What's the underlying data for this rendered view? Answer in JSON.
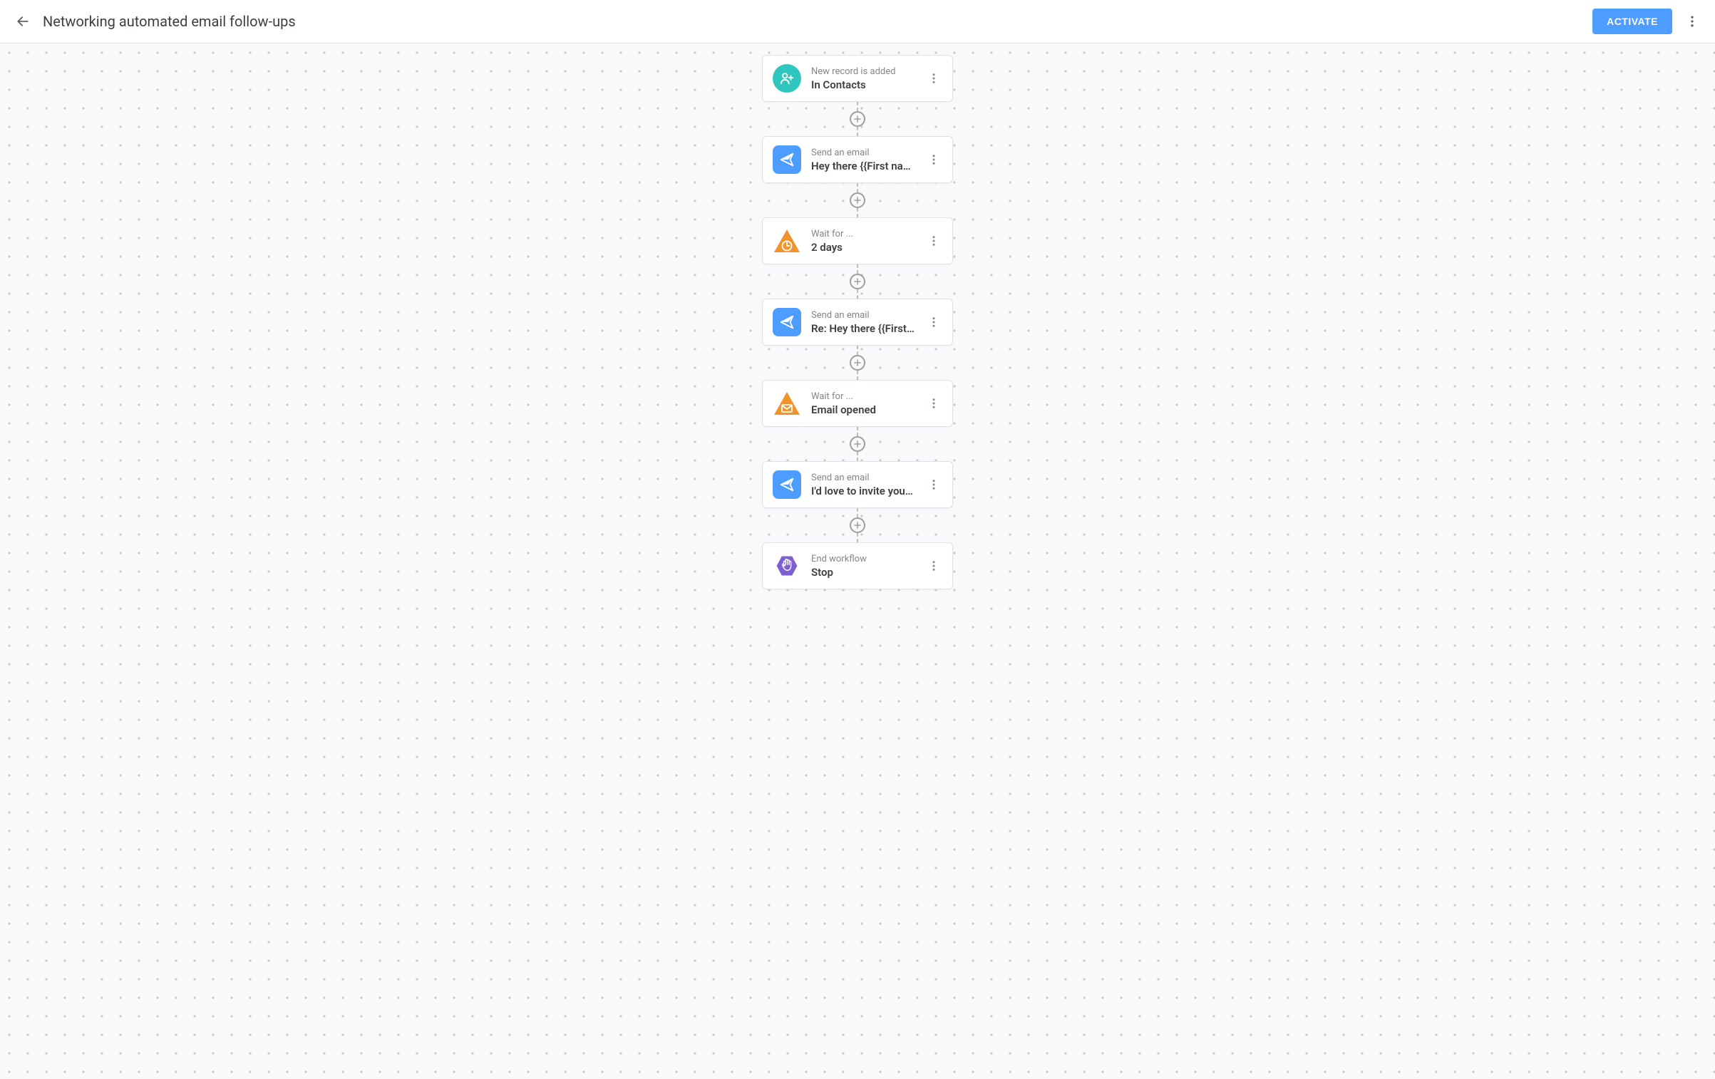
{
  "header": {
    "title": "Networking automated email follow-ups",
    "activate_label": "ACTIVATE"
  },
  "nodes": [
    {
      "label": "New record is added",
      "value": "In Contacts",
      "icon": "person-add",
      "icon_shape": "circle",
      "icon_color": "teal"
    },
    {
      "label": "Send an email",
      "value": "Hey there {{First name…",
      "icon": "send",
      "icon_shape": "rounded",
      "icon_color": "blue"
    },
    {
      "label": "Wait for ...",
      "value": "2 days",
      "icon": "triangle-clock",
      "icon_shape": "triangle",
      "icon_color": "orange"
    },
    {
      "label": "Send an email",
      "value": "Re: Hey there {{First n…",
      "icon": "send",
      "icon_shape": "rounded",
      "icon_color": "blue"
    },
    {
      "label": "Wait for ...",
      "value": "Email opened",
      "icon": "triangle-mail",
      "icon_shape": "triangle",
      "icon_color": "orange"
    },
    {
      "label": "Send an email",
      "value": "I'd love to invite you to…",
      "icon": "send",
      "icon_shape": "rounded",
      "icon_color": "blue"
    },
    {
      "label": "End workflow",
      "value": "Stop",
      "icon": "hand-stop",
      "icon_shape": "hexagon",
      "icon_color": "purple"
    }
  ]
}
